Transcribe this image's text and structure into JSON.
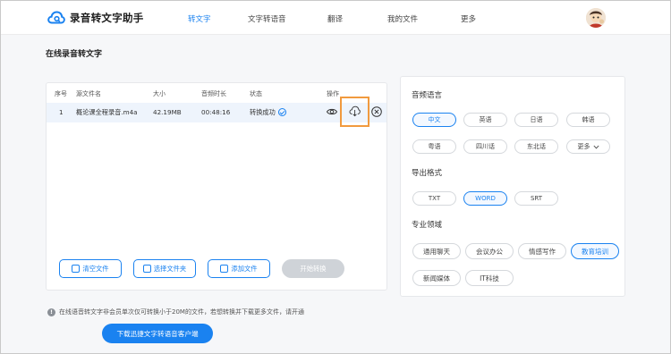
{
  "header": {
    "logo_text": "录音转文字助手",
    "nav": [
      {
        "label": "转文字",
        "active": true
      },
      {
        "label": "文字转语音",
        "active": false
      },
      {
        "label": "翻译",
        "active": false
      },
      {
        "label": "我的文件",
        "active": false
      },
      {
        "label": "更多",
        "active": false
      }
    ]
  },
  "page_title": "在线录音转文字",
  "file_table": {
    "headers": [
      "序号",
      "源文件名",
      "大小",
      "音频时长",
      "状态",
      "操作"
    ],
    "rows": [
      {
        "index": "1",
        "filename": "概论课全程录音.m4a",
        "size": "42.19MB",
        "duration": "00:48:16",
        "status": "转换成功"
      }
    ]
  },
  "file_buttons": {
    "clear": "清空文件",
    "choose_folder": "选择文件夹",
    "add_file": "添加文件",
    "start": "开始转换"
  },
  "options": {
    "language": {
      "title": "音频语言",
      "items": [
        "中文",
        "英语",
        "日语",
        "韩语",
        "粤语",
        "四川话",
        "东北话",
        "更多"
      ],
      "selected": "中文"
    },
    "format": {
      "title": "导出格式",
      "items": [
        "TXT",
        "WORD",
        "SRT"
      ],
      "selected": "WORD"
    },
    "domain": {
      "title": "专业领域",
      "items": [
        "通用聊天",
        "会议办公",
        "情感写作",
        "教育培训",
        "新闻媒体",
        "IT科技"
      ],
      "selected": "教育培训"
    }
  },
  "notice": "在线语音转文字非会员单次仅可转换小于20M的文件，若想转换并下载更多文件，请开通",
  "download_button": "下载迅捷文字转语音客户端",
  "colors": {
    "accent": "#1a82f0",
    "highlight": "#f19a3e",
    "disabled": "#cfd3d8"
  }
}
